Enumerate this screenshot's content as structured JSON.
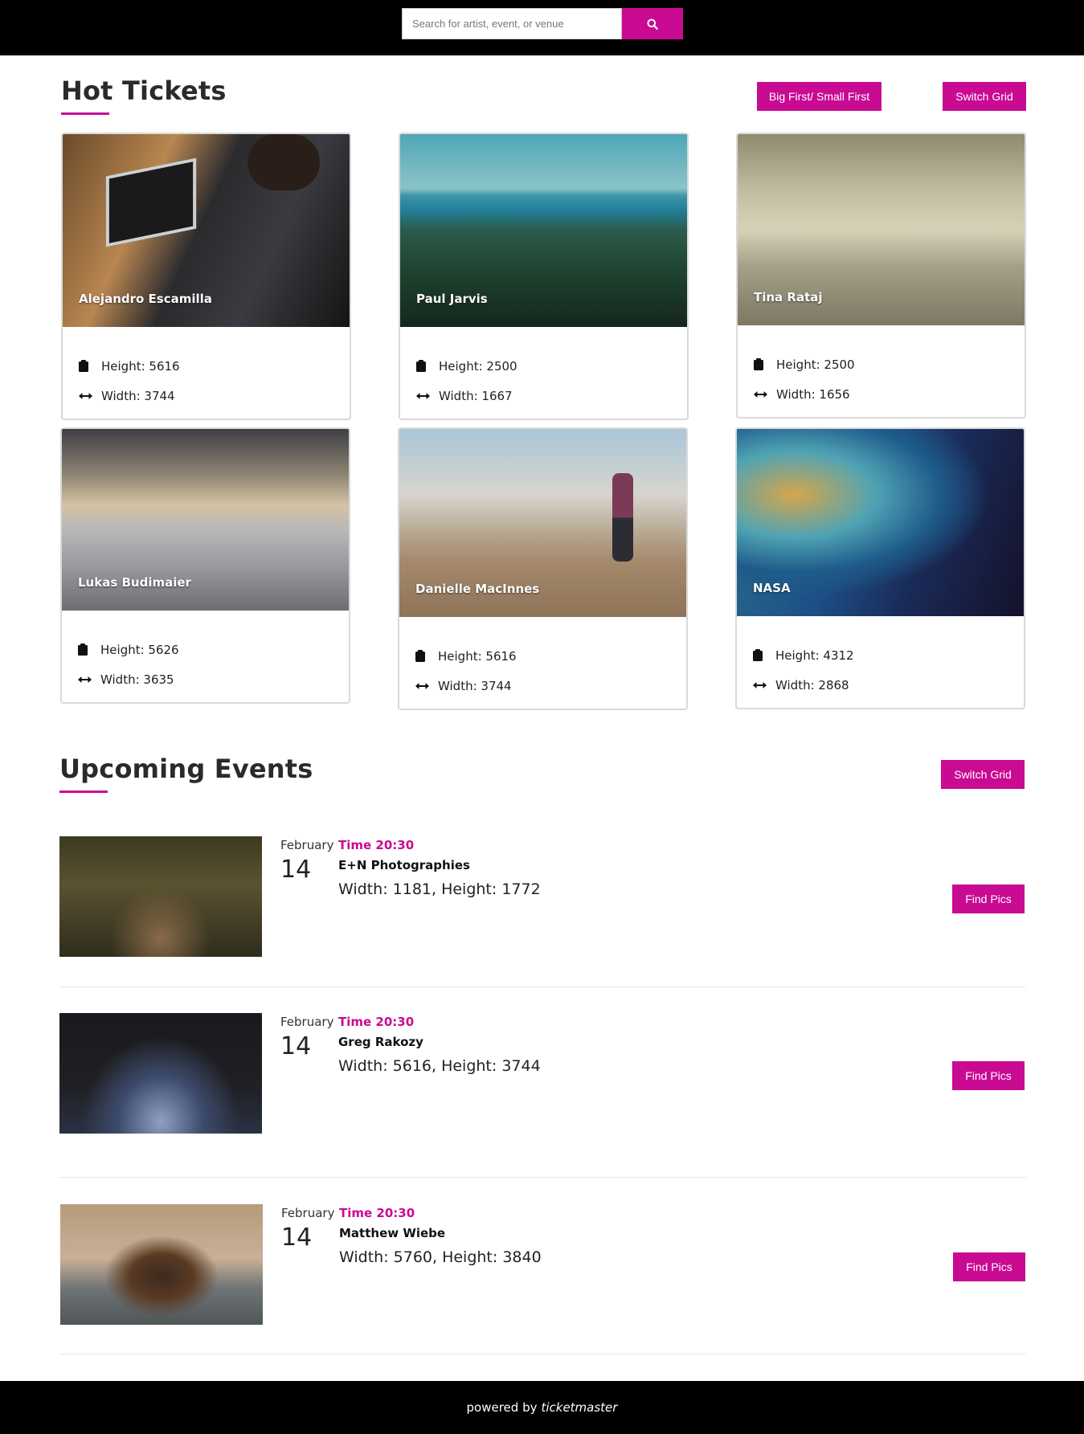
{
  "search": {
    "placeholder": "Search for artist, event, or venue",
    "button_icon": "search-icon"
  },
  "hot_tickets": {
    "title": "Hot Tickets",
    "sort_button": "Big First/ Small First",
    "switch_button": "Switch Grid",
    "height_icon": "clipboard-icon",
    "width_icon": "arrows-horizontal-icon",
    "cards": [
      {
        "author": "Alejandro Escamilla",
        "height": "Height: 5616",
        "width": "Width: 3744"
      },
      {
        "author": "Paul Jarvis",
        "height": "Height: 2500",
        "width": "Width: 1667"
      },
      {
        "author": "Tina Rataj",
        "height": "Height: 2500",
        "width": "Width: 1656"
      },
      {
        "author": "Lukas Budimaier",
        "height": "Height: 5626",
        "width": "Width: 3635"
      },
      {
        "author": "Danielle MacInnes",
        "height": "Height: 5616",
        "width": "Width: 3744"
      },
      {
        "author": "NASA",
        "height": "Height: 4312",
        "width": "Width: 2868"
      }
    ]
  },
  "upcoming": {
    "title": "Upcoming Events",
    "switch_button": "Switch Grid",
    "events": [
      {
        "month": "February",
        "day": "14",
        "time": "Time 20:30",
        "name": "E+N Photographies",
        "dims": "Width: 1181, Height: 1772",
        "button": "Find Pics"
      },
      {
        "month": "February",
        "day": "14",
        "time": "Time 20:30",
        "name": "Greg Rakozy",
        "dims": "Width: 5616, Height: 3744",
        "button": "Find Pics"
      },
      {
        "month": "February",
        "day": "14",
        "time": "Time 20:30",
        "name": "Matthew Wiebe",
        "dims": "Width: 5760, Height: 3840",
        "button": "Find Pics"
      }
    ]
  },
  "footer": {
    "prefix": "powered by",
    "brand": "ticketmaster"
  },
  "colors": {
    "accent": "#c90a93",
    "topbar": "#000000",
    "footer": "#000000"
  }
}
